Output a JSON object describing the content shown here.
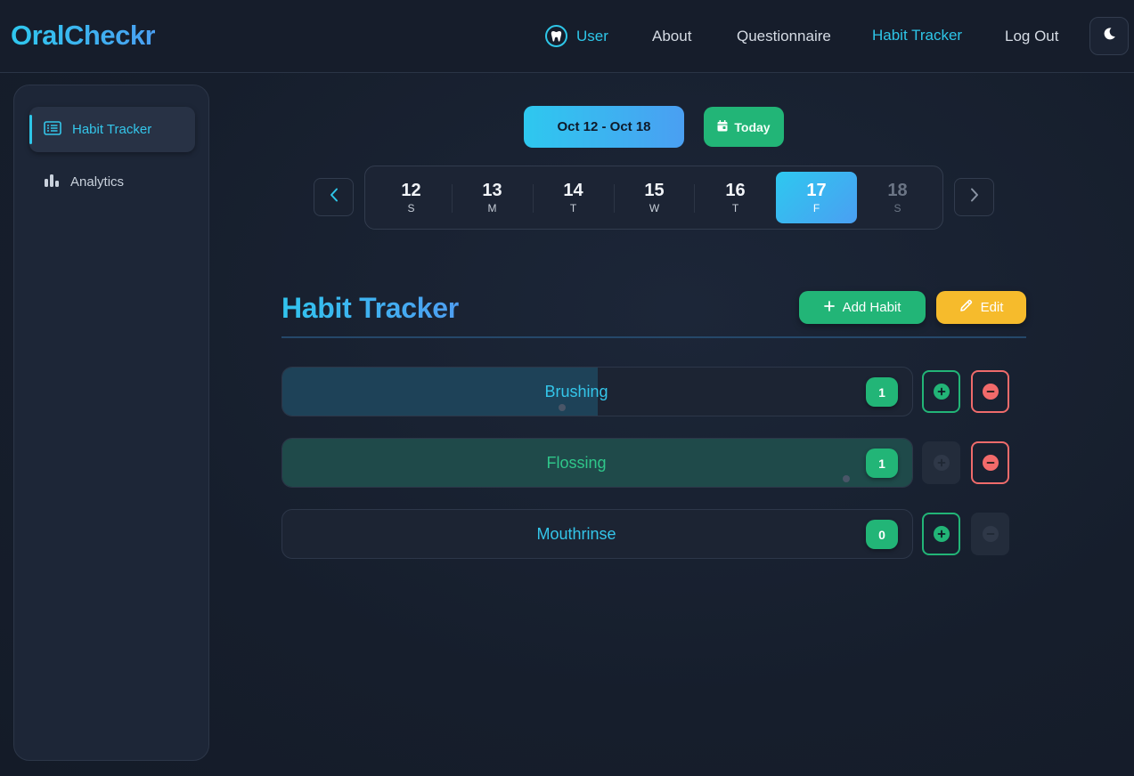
{
  "app": {
    "brand": "OralCheckr"
  },
  "nav": {
    "user_label": "User",
    "about_label": "About",
    "questionnaire_label": "Questionnaire",
    "habit_tracker_label": "Habit Tracker",
    "logout_label": "Log Out",
    "user_icon": "tooth-icon",
    "theme_icon": "moon-icon"
  },
  "sidebar": {
    "items": [
      {
        "label": "Habit Tracker",
        "icon": "list-icon",
        "active": true
      },
      {
        "label": "Analytics",
        "icon": "bar-chart-icon",
        "active": false
      }
    ]
  },
  "week": {
    "range_label": "Oct 12 - Oct 18",
    "today_label": "Today",
    "days": [
      {
        "num": "12",
        "dow": "S"
      },
      {
        "num": "13",
        "dow": "M"
      },
      {
        "num": "14",
        "dow": "T"
      },
      {
        "num": "15",
        "dow": "W"
      },
      {
        "num": "16",
        "dow": "T"
      },
      {
        "num": "17",
        "dow": "F",
        "selected": true
      },
      {
        "num": "18",
        "dow": "S",
        "disabled": true
      }
    ]
  },
  "tracker": {
    "title": "Habit Tracker",
    "add_label": "Add Habit",
    "edit_label": "Edit",
    "habits": [
      {
        "name": "Brushing",
        "count": "1",
        "progress": 0.5,
        "plus_enabled": true,
        "minus_enabled": true
      },
      {
        "name": "Flossing",
        "count": "1",
        "progress": 1.0,
        "plus_enabled": false,
        "minus_enabled": true
      },
      {
        "name": "Mouthrinse",
        "count": "0",
        "progress": 0,
        "plus_enabled": true,
        "minus_enabled": false
      }
    ]
  },
  "colors": {
    "accent": "#2ec6e8",
    "success": "#22b577",
    "warning": "#f6bb2c",
    "danger": "#ef6b6b",
    "background": "#182030"
  }
}
